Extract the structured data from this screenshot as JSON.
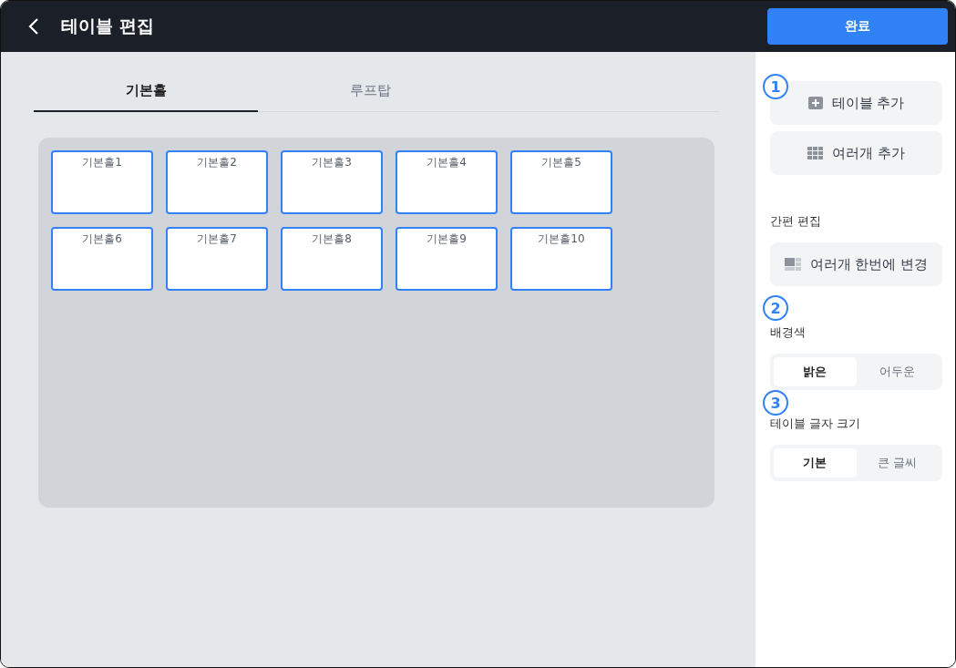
{
  "header": {
    "title": "테이블 편집",
    "done_button": "완료"
  },
  "tabs": [
    {
      "label": "기본홀",
      "selected": true
    },
    {
      "label": "루프탑",
      "selected": false
    }
  ],
  "tables": [
    "기본홀1",
    "기본홀2",
    "기본홀3",
    "기본홀4",
    "기본홀5",
    "기본홀6",
    "기본홀7",
    "기본홀8",
    "기본홀9",
    "기본홀10"
  ],
  "sidebar": {
    "add_buttons": [
      {
        "kind": "single",
        "label": "테이블 추가"
      },
      {
        "kind": "multi",
        "label": "여러개 추가"
      }
    ],
    "step_badges": [
      "1",
      "2",
      "3"
    ],
    "quick_edit": {
      "label": "간편 편집",
      "button": "여러개 한번에 변경"
    },
    "background": {
      "label": "배경색",
      "options": [
        {
          "label": "밝은",
          "selected": true
        },
        {
          "label": "어두운",
          "selected": false
        }
      ]
    },
    "font_size": {
      "label": "테이블 글자 크기",
      "options": [
        {
          "label": "기본",
          "selected": true
        },
        {
          "label": "큰 글씨",
          "selected": false
        }
      ]
    }
  }
}
